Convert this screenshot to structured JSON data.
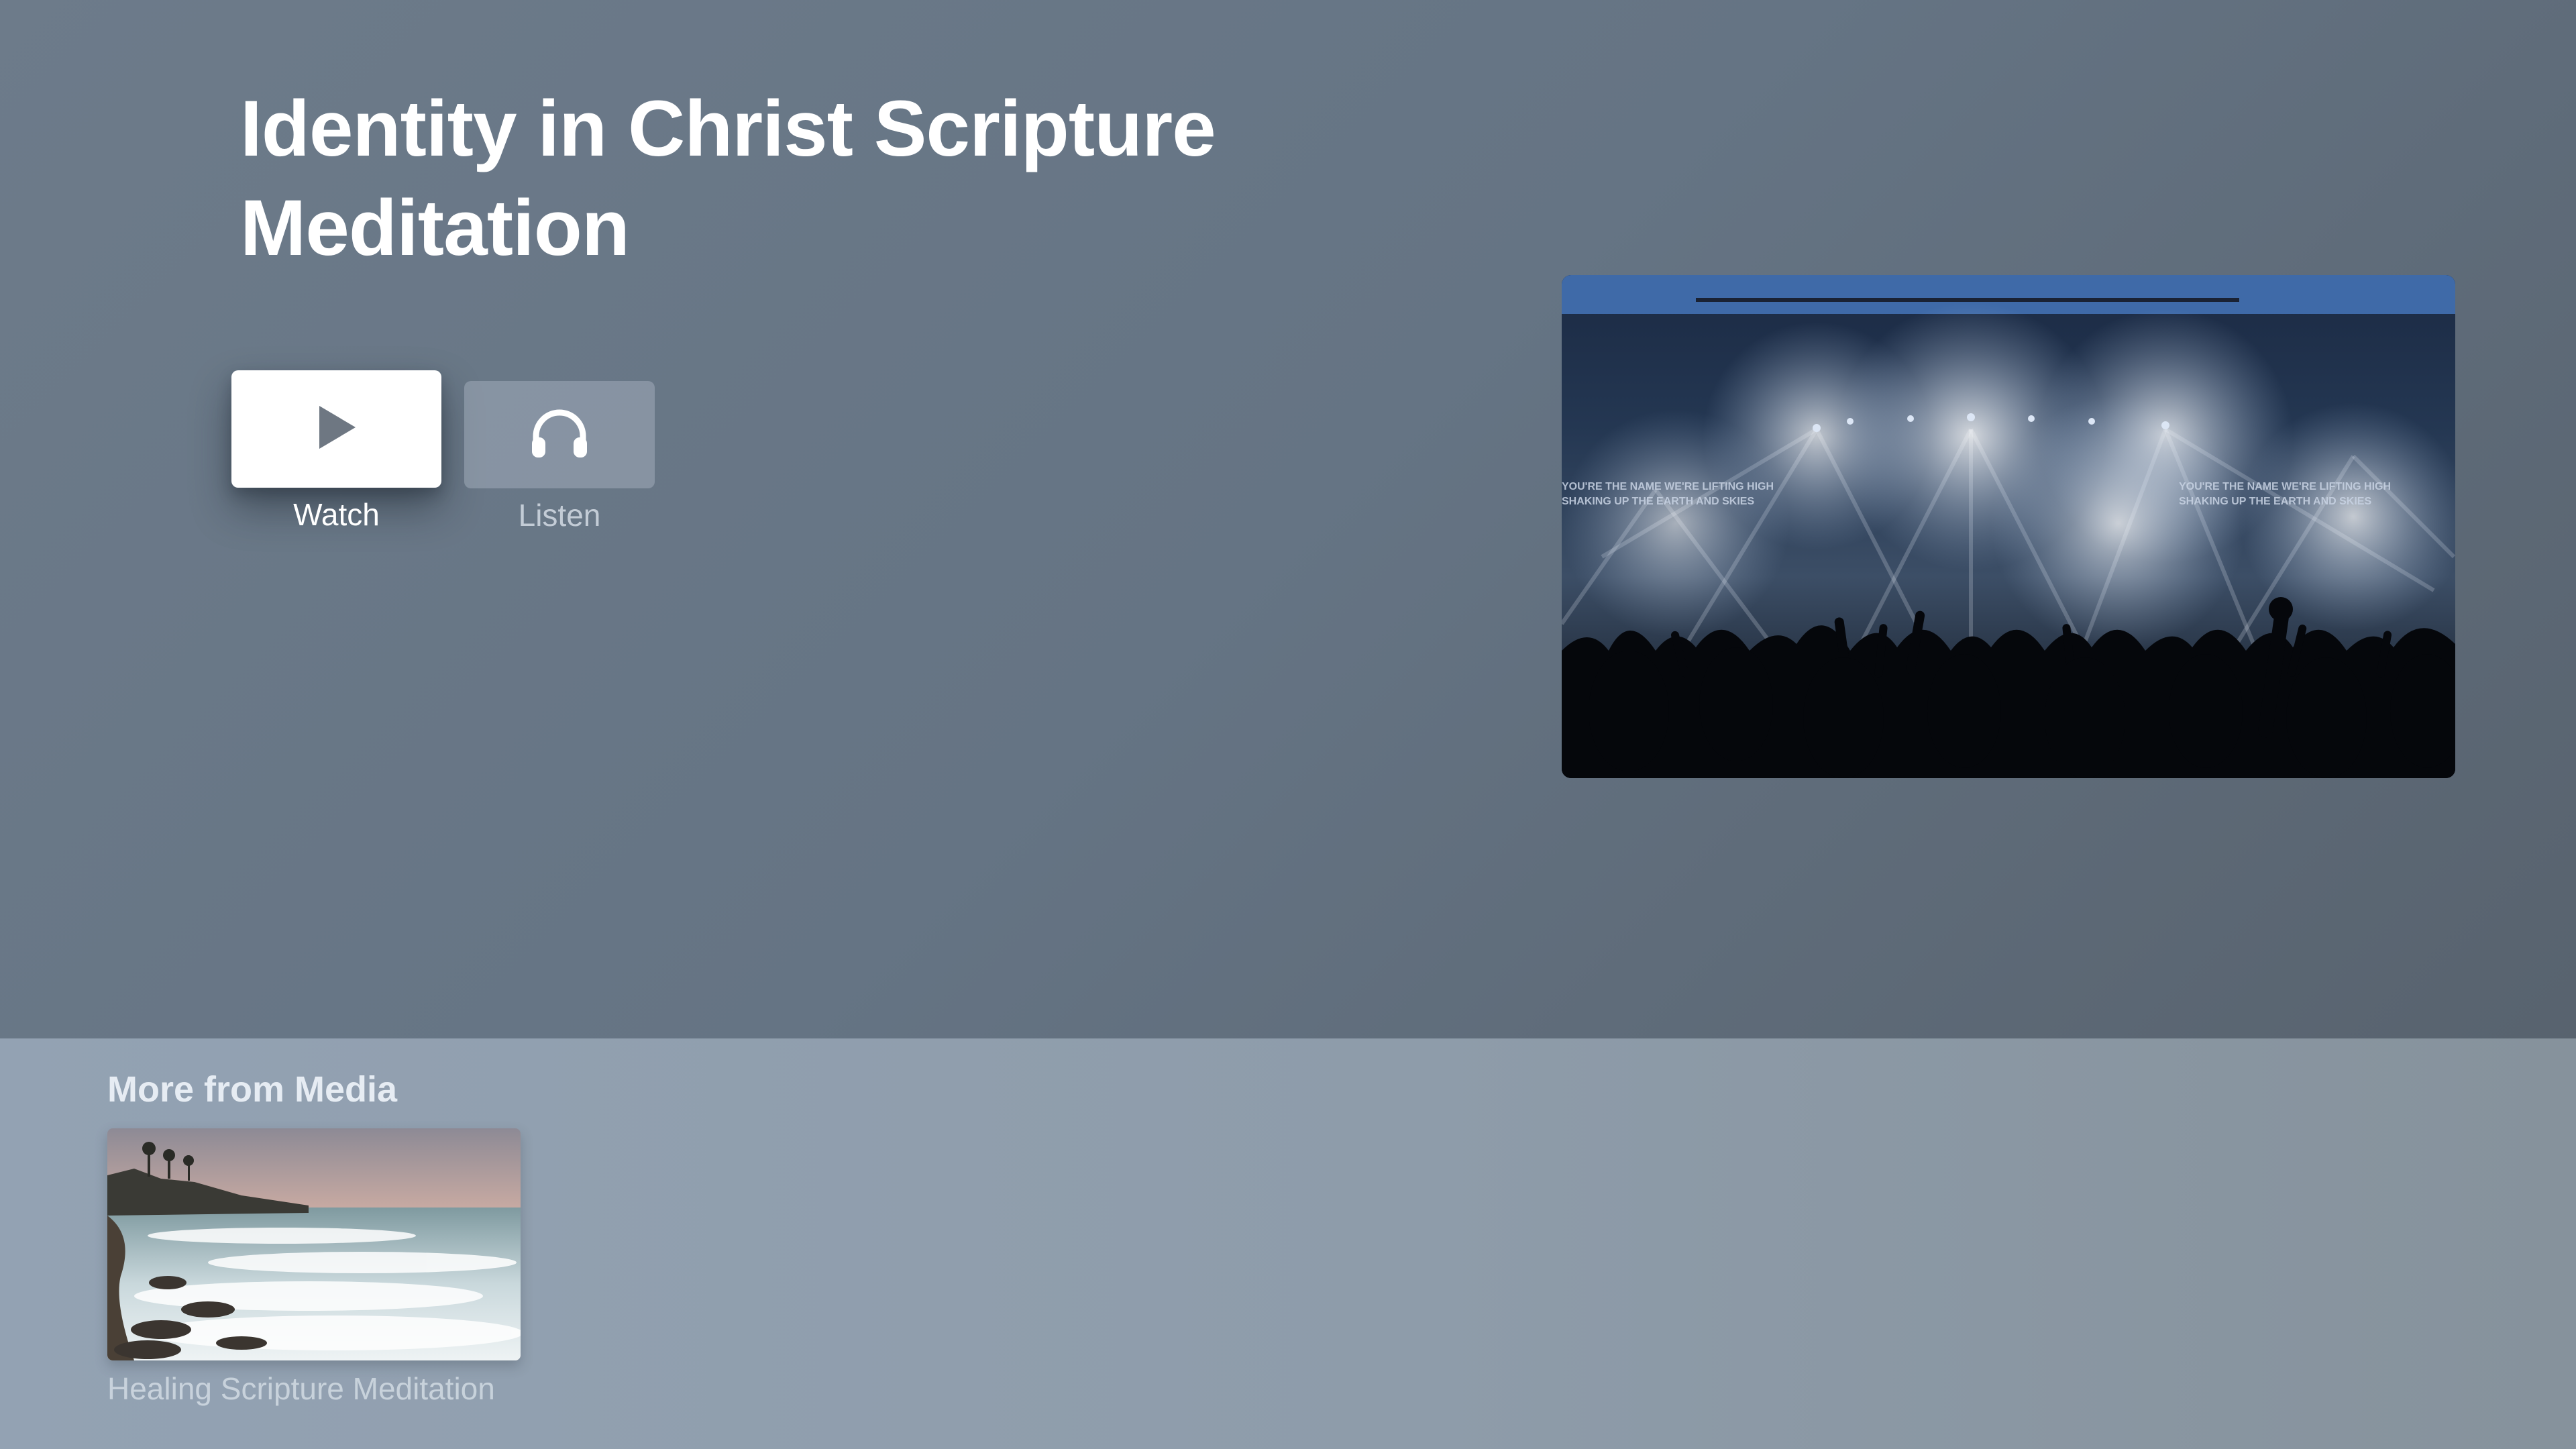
{
  "hero": {
    "title": "Identity in Christ Scripture Meditation",
    "artwork": {
      "icon": "concert-crowd-image",
      "overlay_text_left_1": "YOU'RE THE NAME WE'RE LIFTING HIGH",
      "overlay_text_left_2": "SHAKING UP THE EARTH AND SKIES",
      "overlay_text_right_1": "YOU'RE THE NAME WE'RE LIFTING HIGH",
      "overlay_text_right_2": "SHAKING UP THE EARTH AND SKIES"
    }
  },
  "actions": [
    {
      "label": "Watch",
      "icon": "play-icon",
      "focused": true
    },
    {
      "label": "Listen",
      "icon": "headphones-icon",
      "focused": false
    }
  ],
  "shelf": {
    "title": "More from Media",
    "items": [
      {
        "caption": "Healing Scripture Meditation",
        "icon": "ocean-shore-image"
      }
    ]
  },
  "colors": {
    "background": "#657484",
    "shelf_background": "#93a2b3",
    "focused_button": "#ffffff",
    "unfocused_button": "#a0acba"
  }
}
